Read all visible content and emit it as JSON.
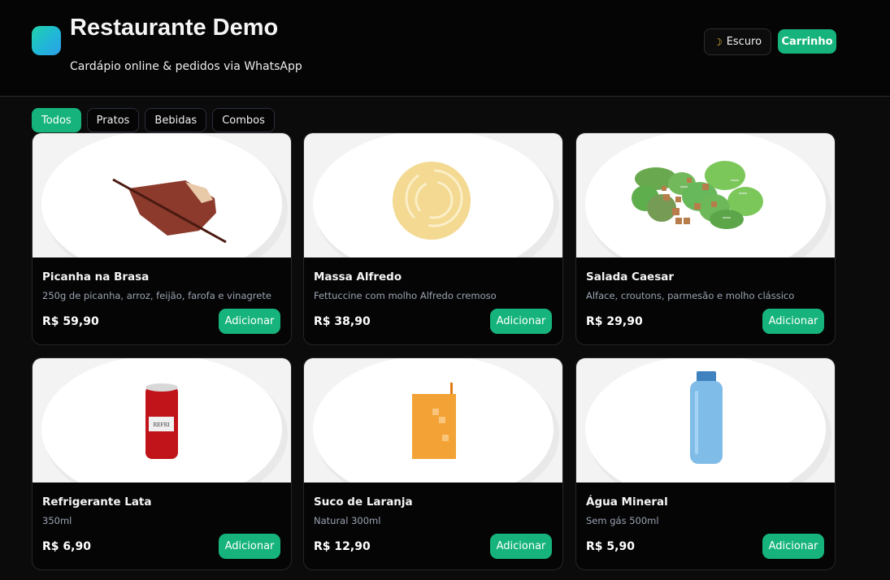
{
  "header": {
    "title": "Restaurante Demo",
    "subtitle": "Cardápio online & pedidos via WhatsApp",
    "theme_icon": "moon-icon",
    "theme_label": "Escuro",
    "cart_label": "Carrinho"
  },
  "colors": {
    "accent": "#16b47c",
    "background": "#0b0b0b"
  },
  "tabs": [
    {
      "label": "Todos",
      "active": true
    },
    {
      "label": "Pratos",
      "active": false
    },
    {
      "label": "Bebidas",
      "active": false
    },
    {
      "label": "Combos",
      "active": false
    }
  ],
  "products": [
    {
      "name": "Picanha na Brasa",
      "description": "250g de picanha, arroz, feijão, farofa e vinagrete",
      "price": "R$ 59,90",
      "button": "Adicionar"
    },
    {
      "name": "Massa Alfredo",
      "description": "Fettuccine com molho Alfredo cremoso",
      "price": "R$ 38,90",
      "button": "Adicionar"
    },
    {
      "name": "Salada Caesar",
      "description": "Alface, croutons, parmesão e molho clássico",
      "price": "R$ 29,90",
      "button": "Adicionar"
    },
    {
      "name": "Refrigerante Lata",
      "description": "350ml",
      "price": "R$ 6,90",
      "button": "Adicionar",
      "label_text": "REFRI"
    },
    {
      "name": "Suco de Laranja",
      "description": "Natural 300ml",
      "price": "R$ 12,90",
      "button": "Adicionar"
    },
    {
      "name": "Água Mineral",
      "description": "Sem gás 500ml",
      "price": "R$ 5,90",
      "button": "Adicionar"
    }
  ]
}
